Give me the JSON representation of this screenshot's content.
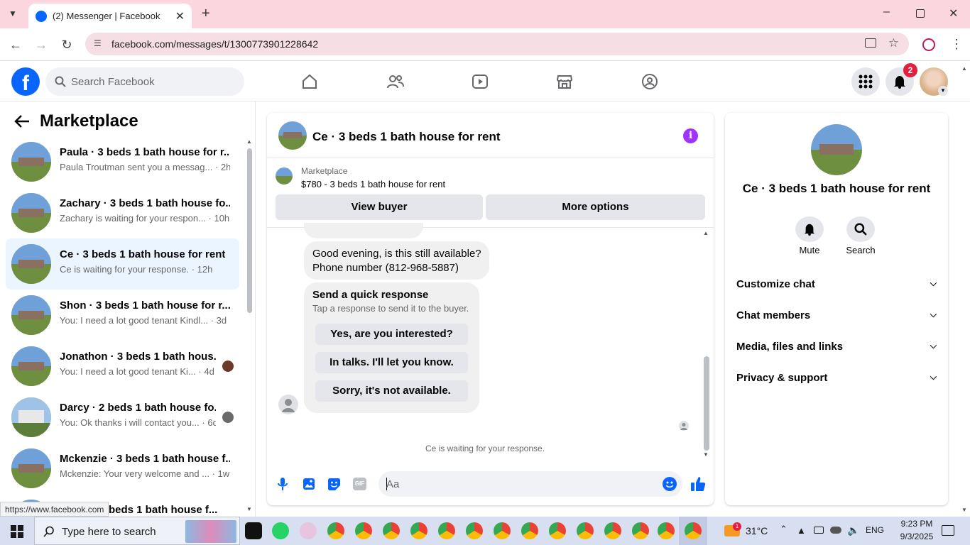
{
  "browser": {
    "tab_title": "(2) Messenger | Facebook",
    "url": "facebook.com/messages/t/1300773901228642",
    "status_url": "https://www.facebook.com"
  },
  "header": {
    "search_placeholder": "Search Facebook",
    "notification_count": "2"
  },
  "sidebar": {
    "title": "Marketplace",
    "conversations": [
      {
        "name": "Paula · 3 beds 1 bath house for r...",
        "preview": "Paula Troutman sent you a messag... · 2h"
      },
      {
        "name": "Zachary · 3 beds 1 bath house fo...",
        "preview": "Zachary is waiting for your respon... · 10h"
      },
      {
        "name": "Ce · 3 beds 1 bath house for rent",
        "preview": "Ce is waiting for your response. · 12h"
      },
      {
        "name": "Shon · 3 beds 1 bath house for r...",
        "preview": "You: I need a lot good tenant Kindl... · 3d"
      },
      {
        "name": "Jonathon · 3 beds 1 bath hous...",
        "preview": "You: I need a lot good tenant Ki... · 4d"
      },
      {
        "name": "Darcy · 2 beds 1 bath house fo...",
        "preview": "You: Ok thanks i will contact you... · 6d"
      },
      {
        "name": "Mckenzie · 3 beds 1 bath house f...",
        "preview": "Mckenzie: Your very welcome and ... · 1w"
      },
      {
        "name": "beds 1 bath house f..."
      }
    ]
  },
  "chat": {
    "title": "Ce · 3 beds 1 bath house for rent",
    "listing_label": "Marketplace",
    "listing_title": "$780 - 3 beds 1 bath house for rent",
    "view_buyer": "View buyer",
    "more_options": "More options",
    "message_line1": "Good evening, is this still available?",
    "message_line2": "Phone number (812-968-5887)",
    "quick_title": "Send a quick response",
    "quick_sub": "Tap a response to send it to the buyer.",
    "quick_responses": [
      "Yes, are you interested?",
      "In talks. I'll let you know.",
      "Sorry, it's not available."
    ],
    "waiting": "Ce is waiting for your response.",
    "composer_placeholder": "Aa",
    "gif_label": "GIF"
  },
  "info_panel": {
    "title": "Ce · 3 beds 1 bath house for rent",
    "mute": "Mute",
    "search": "Search",
    "sections": [
      "Customize chat",
      "Chat members",
      "Media, files and links",
      "Privacy & support"
    ]
  },
  "taskbar": {
    "search_placeholder": "Type here to search",
    "temperature": "31°C",
    "language": "ENG",
    "time": "9:23 PM",
    "date": "9/3/2025",
    "weather_badge": "1"
  },
  "colors": {
    "accent": "#0866ff",
    "messenger_purple": "#a033ff",
    "badge_red": "#e41e3f"
  }
}
